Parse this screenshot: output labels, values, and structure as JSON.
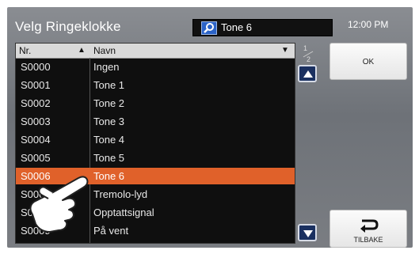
{
  "header": {
    "title": "Velg Ringeklokke",
    "search_value": "Tone 6",
    "time": "12:00 PM"
  },
  "list": {
    "columns": {
      "nr": "Nr.",
      "name": "Navn"
    },
    "rows": [
      {
        "nr": "S0000",
        "name": "Ingen"
      },
      {
        "nr": "S0001",
        "name": "Tone 1"
      },
      {
        "nr": "S0002",
        "name": "Tone 2"
      },
      {
        "nr": "S0003",
        "name": "Tone 3"
      },
      {
        "nr": "S0004",
        "name": "Tone 4"
      },
      {
        "nr": "S0005",
        "name": "Tone 5"
      },
      {
        "nr": "S0006",
        "name": "Tone 6"
      },
      {
        "nr": "S0007",
        "name": "Tremolo-lyd"
      },
      {
        "nr": "S0008",
        "name": "Opptattsignal"
      },
      {
        "nr": "S0009",
        "name": "På vent"
      }
    ],
    "selected_row": "S0006"
  },
  "pagination": {
    "current": "1",
    "total": "2"
  },
  "buttons": {
    "ok": "OK",
    "back": "TILBAKE"
  },
  "colors": {
    "accent": "#e0612a",
    "search_icon": "#2b63c7"
  },
  "icons": {
    "search": "search-icon",
    "up": "up-arrow-icon",
    "down": "down-arrow-icon",
    "back": "return-arrow-icon",
    "hand": "hand-pointer-icon"
  }
}
